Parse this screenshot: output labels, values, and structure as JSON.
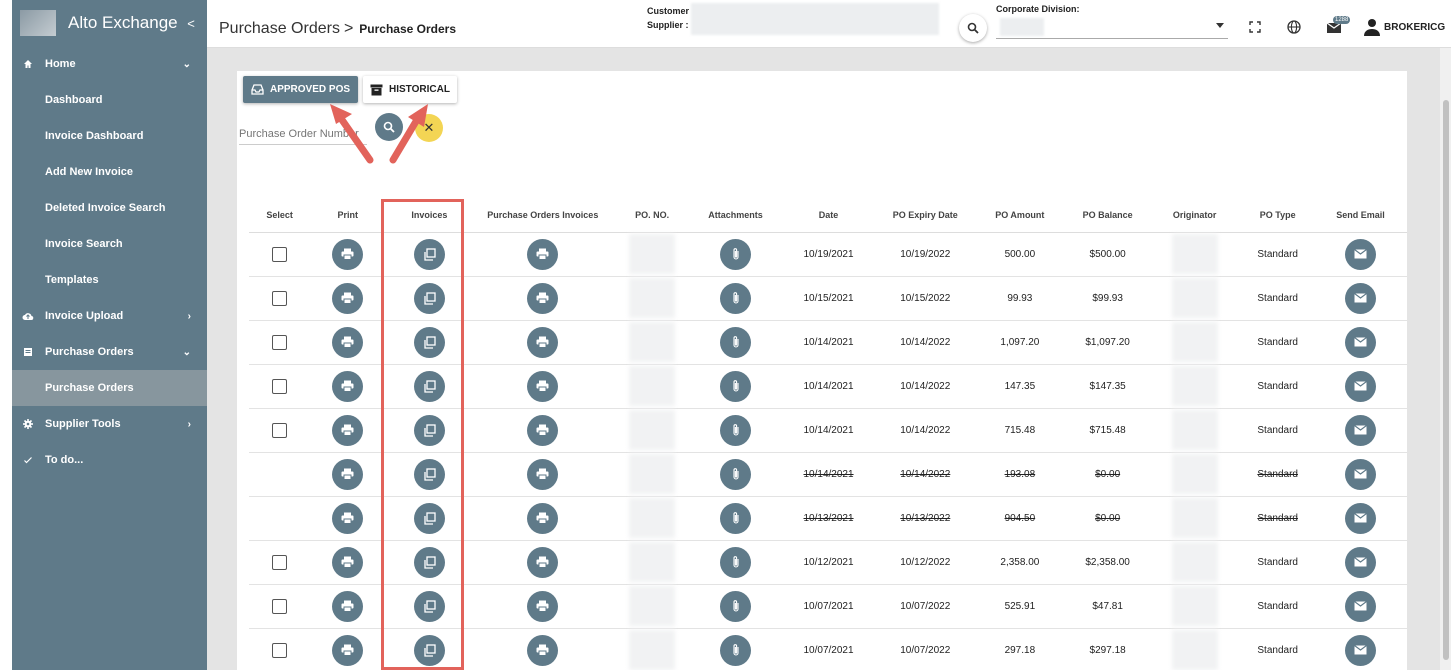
{
  "app": {
    "title": "Alto Exchange"
  },
  "sidebar": {
    "items": [
      {
        "label": "Home",
        "icon": "home-icon",
        "arrow": "chevron-down-icon",
        "type": "top"
      },
      {
        "label": "Dashboard",
        "type": "sub"
      },
      {
        "label": "Invoice Dashboard",
        "type": "sub"
      },
      {
        "label": "Add New Invoice",
        "type": "sub"
      },
      {
        "label": "Deleted Invoice Search",
        "type": "sub"
      },
      {
        "label": "Invoice Search",
        "type": "sub"
      },
      {
        "label": "Templates",
        "type": "sub"
      },
      {
        "label": "Invoice Upload",
        "icon": "cloud-upload-icon",
        "arrow": "chevron-right-icon",
        "type": "top"
      },
      {
        "label": "Purchase Orders",
        "icon": "list-icon",
        "arrow": "chevron-down-icon",
        "type": "top"
      },
      {
        "label": "Purchase Orders",
        "type": "sub",
        "active": true
      },
      {
        "label": "Supplier Tools",
        "icon": "gear-icon",
        "arrow": "chevron-right-icon",
        "type": "top"
      },
      {
        "label": "To do...",
        "icon": "check-icon",
        "type": "top"
      }
    ]
  },
  "header": {
    "breadcrumb_main": "Purchase Orders",
    "breadcrumb_sep": ">",
    "breadcrumb_current": "Purchase Orders",
    "customer_label": "Customer",
    "supplier_label": "Supplier :",
    "corporate_label": "Corporate Division:",
    "notification_count": "1288",
    "username": "BROKERICG"
  },
  "toolbar": {
    "approved_label": "APPROVED POS",
    "historical_label": "HISTORICAL",
    "search_placeholder": "Purchase Order Number",
    "clear_glyph": "✕"
  },
  "table": {
    "columns": [
      "Select",
      "Print",
      "Invoices",
      "Purchase Orders Invoices",
      "PO. NO.",
      "Attachments",
      "Date",
      "PO Expiry Date",
      "PO Amount",
      "PO Balance",
      "Originator",
      "PO Type",
      "Send Email"
    ],
    "rows": [
      {
        "select": true,
        "date": "10/19/2021",
        "expiry": "10/19/2022",
        "amount": "500.00",
        "balance": "$500.00",
        "type": "Standard",
        "struck": false
      },
      {
        "select": true,
        "date": "10/15/2021",
        "expiry": "10/15/2022",
        "amount": "99.93",
        "balance": "$99.93",
        "type": "Standard",
        "struck": false
      },
      {
        "select": true,
        "date": "10/14/2021",
        "expiry": "10/14/2022",
        "amount": "1,097.20",
        "balance": "$1,097.20",
        "type": "Standard",
        "struck": false
      },
      {
        "select": true,
        "date": "10/14/2021",
        "expiry": "10/14/2022",
        "amount": "147.35",
        "balance": "$147.35",
        "type": "Standard",
        "struck": false
      },
      {
        "select": true,
        "date": "10/14/2021",
        "expiry": "10/14/2022",
        "amount": "715.48",
        "balance": "$715.48",
        "type": "Standard",
        "struck": false
      },
      {
        "select": false,
        "date": "10/14/2021",
        "expiry": "10/14/2022",
        "amount": "193.08",
        "balance": "$0.00",
        "type": "Standard",
        "struck": true
      },
      {
        "select": false,
        "date": "10/13/2021",
        "expiry": "10/13/2022",
        "amount": "904.50",
        "balance": "$0.00",
        "type": "Standard",
        "struck": true
      },
      {
        "select": true,
        "date": "10/12/2021",
        "expiry": "10/12/2022",
        "amount": "2,358.00",
        "balance": "$2,358.00",
        "type": "Standard",
        "struck": false
      },
      {
        "select": true,
        "date": "10/07/2021",
        "expiry": "10/07/2022",
        "amount": "525.91",
        "balance": "$47.81",
        "type": "Standard",
        "struck": false
      },
      {
        "select": true,
        "date": "10/07/2021",
        "expiry": "10/07/2022",
        "amount": "297.18",
        "balance": "$297.18",
        "type": "Standard",
        "struck": false
      }
    ]
  },
  "colors": {
    "accent": "#5f7a89",
    "annotation": "#e2635b",
    "clear": "#f3d554"
  }
}
